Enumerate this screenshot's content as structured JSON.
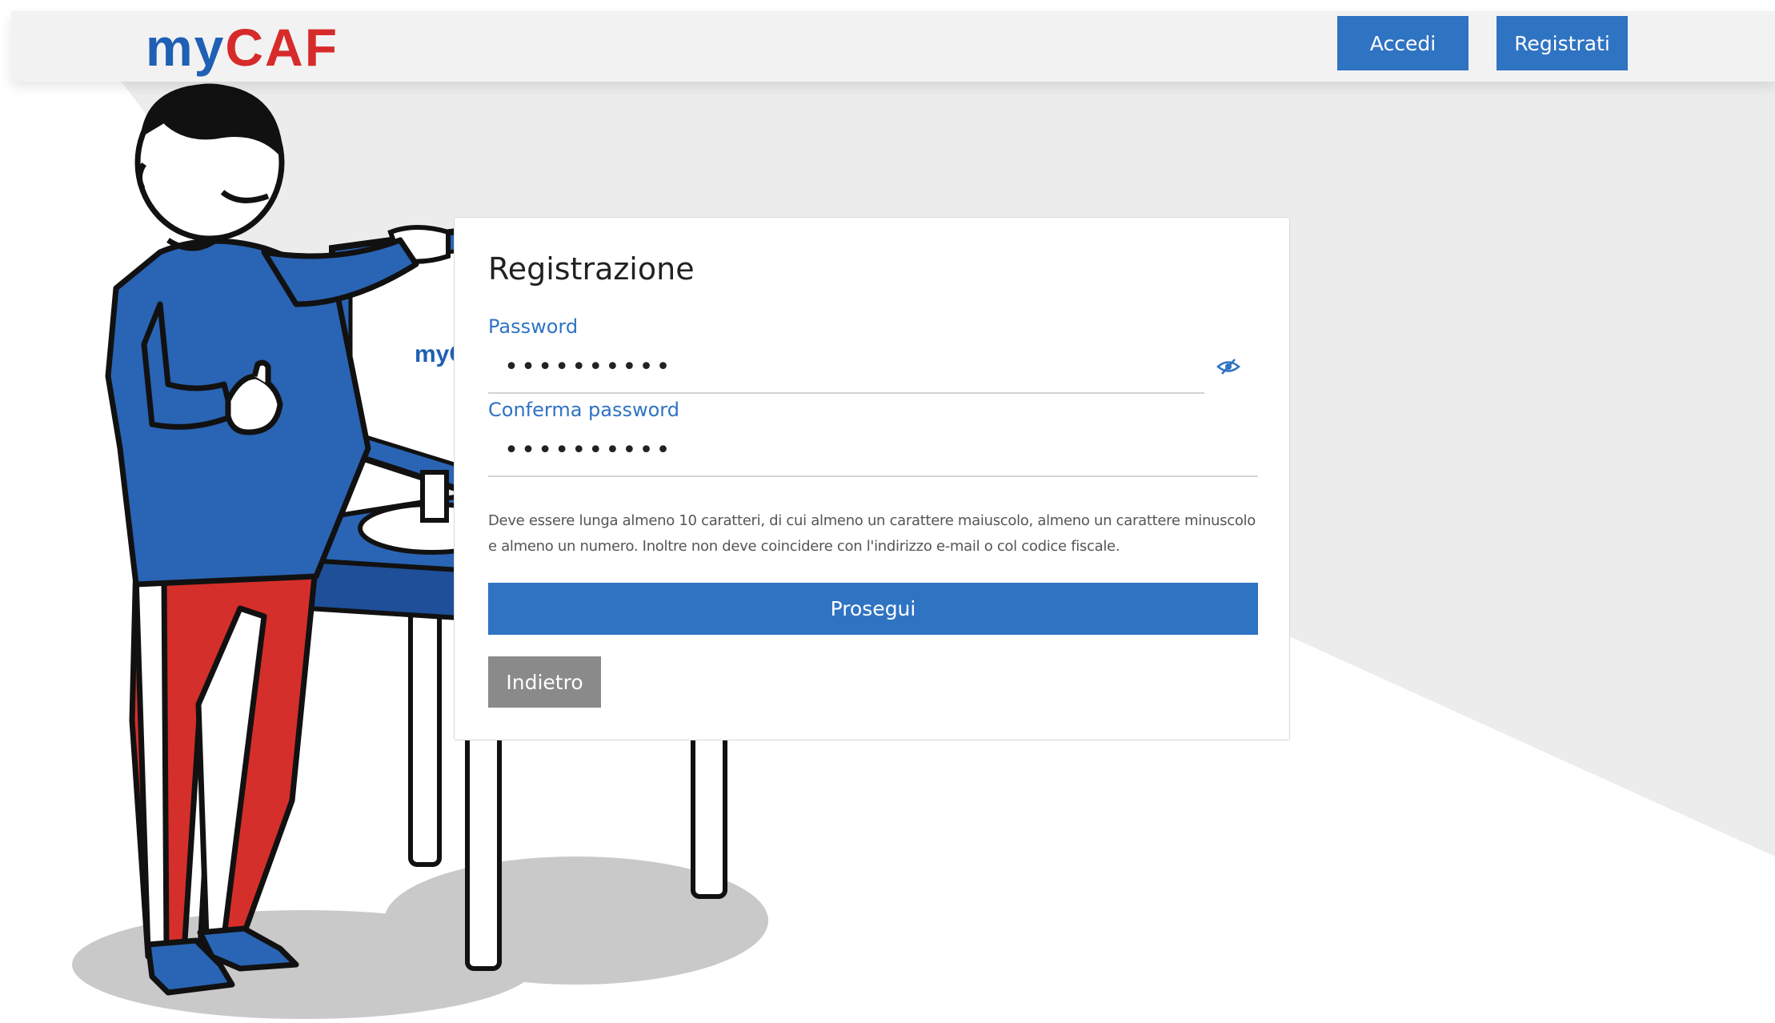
{
  "header": {
    "logo_my": "my",
    "logo_caf": "CAF",
    "login_label": "Accedi",
    "register_label": "Registrati"
  },
  "illustration": {
    "monitor_logo": "myC"
  },
  "form": {
    "title": "Registrazione",
    "password_label": "Password",
    "password_value": "••••••••••",
    "confirm_label": "Conferma password",
    "confirm_value": "••••••••••",
    "hint_text": "Deve essere lunga almeno 10 caratteri, di cui almeno un carattere maiuscolo, almeno un carattere minuscolo e almeno un numero. Inoltre non deve coincidere con l'indirizzo e-mail o col codice fiscale.",
    "continue_label": "Prosegui",
    "back_label": "Indietro"
  },
  "icons": {
    "toggle_visibility": "eye-slash-icon"
  },
  "colors": {
    "primary": "#2f73c3",
    "logo_blue": "#1f5fb4",
    "logo_red": "#d72b2b",
    "secondary_button": "#8a8a8a",
    "shirt": "#2a64b4",
    "pants": "#d42f2a"
  }
}
